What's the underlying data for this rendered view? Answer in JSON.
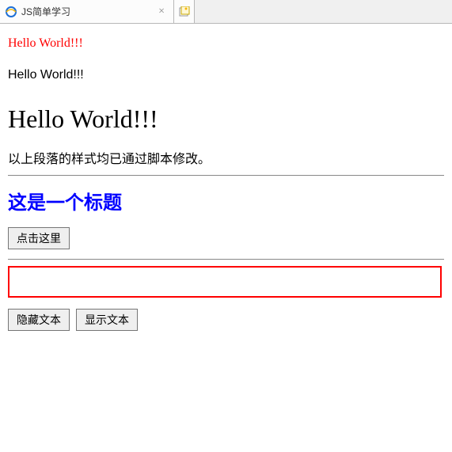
{
  "tab": {
    "title": "JS简单学习",
    "close_glyph": "×"
  },
  "content": {
    "p1": "Hello World!!!",
    "p2": "Hello World!!!",
    "big_heading": "Hello World!!!",
    "description": "以上段落的样式均已通过脚本修改。",
    "blue_heading": "这是一个标题",
    "btn_click_here": "点击这里",
    "btn_hide_text": "隐藏文本",
    "btn_show_text": "显示文本"
  }
}
